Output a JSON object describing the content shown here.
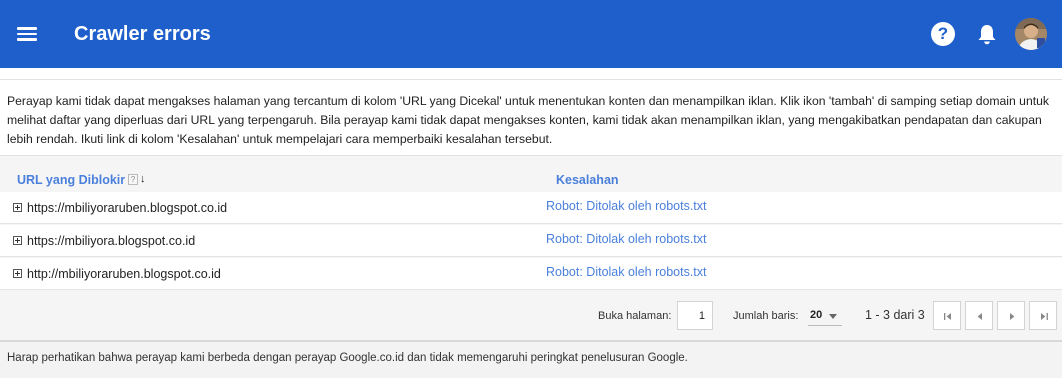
{
  "app": {
    "title": "Crawler errors",
    "menu_icon": "hamburger-menu-icon",
    "help_icon": "help-icon",
    "help_glyph": "?",
    "notifications_icon": "bell-icon",
    "brand_color": "#1e5fcc",
    "link_color": "#4a80dc"
  },
  "intro": {
    "text": "Perayap kami tidak dapat mengakses halaman yang tercantum di kolom 'URL yang Dicekal' untuk menentukan konten dan menampilkan iklan. Klik ikon 'tambah' di samping setiap domain untuk melihat daftar yang diperluas dari URL yang terpengaruh. Bila perayap kami tidak dapat mengakses konten, kami tidak akan menampilkan iklan, yang mengakibatkan pendapatan dan cakupan lebih rendah. Ikuti link di kolom 'Kesalahan' untuk mempelajari cara memperbaiki kesalahan tersebut."
  },
  "table": {
    "columns": {
      "url": "URL yang Diblokir",
      "error": "Kesalahan"
    },
    "help_glyph": "?",
    "sort_glyph": "↓",
    "rows": [
      {
        "url": "https://mbiliyoraruben.blogspot.co.id",
        "error": "Robot: Ditolak oleh robots.txt"
      },
      {
        "url": "https://mbiliyora.blogspot.co.id",
        "error": "Robot: Ditolak oleh robots.txt"
      },
      {
        "url": "http://mbiliyoraruben.blogspot.co.id",
        "error": "Robot: Ditolak oleh robots.txt"
      }
    ]
  },
  "pagination": {
    "go_to_page_label": "Buka halaman:",
    "page_value": "1",
    "rows_label": "Jumlah baris:",
    "rows_value": "20",
    "range_text": "1 - 3 dari 3",
    "first_icon": "first-page-icon",
    "prev_icon": "previous-page-icon",
    "next_icon": "next-page-icon",
    "last_icon": "last-page-icon"
  },
  "footer": {
    "note": "Harap perhatikan bahwa perayap kami berbeda dengan perayap Google.co.id dan tidak memengaruhi peringkat penelusuran Google."
  }
}
